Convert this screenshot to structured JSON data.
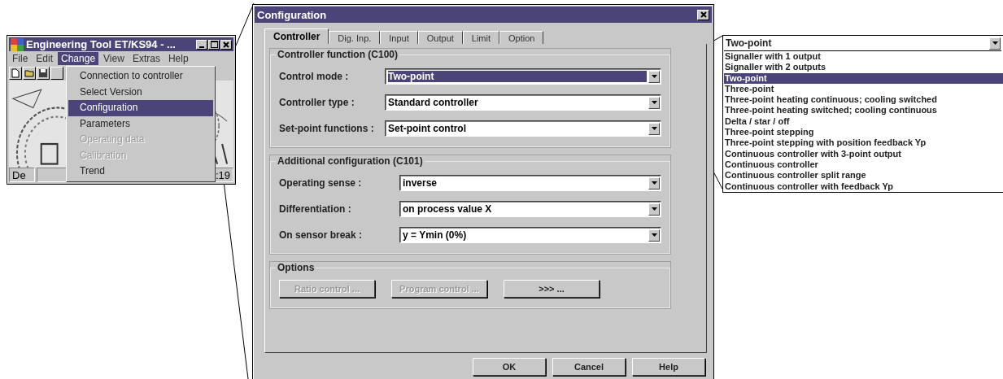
{
  "main_window": {
    "title": "Engineering Tool ET/KS94 - ...",
    "menu": [
      {
        "label": "File",
        "selected": false
      },
      {
        "label": "Edit",
        "selected": false
      },
      {
        "label": "Change",
        "selected": true
      },
      {
        "label": "View",
        "selected": false
      },
      {
        "label": "Extras",
        "selected": false
      },
      {
        "label": "Help",
        "selected": false
      }
    ],
    "change_menu": [
      {
        "label": "Connection to controller",
        "selected": false,
        "disabled": false
      },
      {
        "label": "Select Version",
        "selected": false,
        "disabled": false
      },
      {
        "label": "Configuration",
        "selected": true,
        "disabled": false
      },
      {
        "label": "Parameters",
        "selected": false,
        "disabled": false
      },
      {
        "label": "Operating data",
        "selected": false,
        "disabled": true
      },
      {
        "label": "Calibration",
        "selected": false,
        "disabled": true
      },
      {
        "label": "Trend",
        "selected": false,
        "disabled": false
      }
    ],
    "status_bar": {
      "left": "De",
      "right": ":19"
    }
  },
  "dialog": {
    "title": "Configuration",
    "tabs": [
      {
        "label": "Controller",
        "selected": true
      },
      {
        "label": "Dig. Inp.",
        "selected": false
      },
      {
        "label": "Input",
        "selected": false
      },
      {
        "label": "Output",
        "selected": false
      },
      {
        "label": "Limit",
        "selected": false
      },
      {
        "label": "Option",
        "selected": false
      }
    ],
    "groups": [
      {
        "title": "Controller function (C100)",
        "fields": [
          {
            "label": "Control mode :",
            "value": "Two-point",
            "focused": true
          },
          {
            "label": "Controller type :",
            "value": "Standard controller",
            "focused": false
          },
          {
            "label": "Set-point functions :",
            "value": "Set-point control",
            "focused": false
          }
        ]
      },
      {
        "title": "Additional configuration (C101)",
        "fields": [
          {
            "label": "Operating sense :",
            "value": "inverse",
            "focused": false
          },
          {
            "label": "Differentiation :",
            "value": "on process value X",
            "focused": false
          },
          {
            "label": "On sensor break :",
            "value": "y = Ymin (0%)",
            "focused": false
          }
        ]
      }
    ],
    "options": {
      "title": "Options",
      "buttons": [
        {
          "label": "Ratio control ...",
          "disabled": true
        },
        {
          "label": "Program control ...",
          "disabled": true
        },
        {
          "label": ">>> ...",
          "disabled": false
        }
      ]
    },
    "buttons": [
      "OK",
      "Cancel",
      "Help"
    ]
  },
  "dropdown": {
    "value": "Two-point",
    "items": [
      {
        "label": "Signaller with 1 output",
        "selected": false
      },
      {
        "label": "Signaller with 2 outputs",
        "selected": false
      },
      {
        "label": "Two-point",
        "selected": true
      },
      {
        "label": "Three-point",
        "selected": false
      },
      {
        "label": "Three-point heating continuous; cooling switched",
        "selected": false
      },
      {
        "label": "Three-point heating switched; cooling continuous",
        "selected": false
      },
      {
        "label": "Delta / star / off",
        "selected": false
      },
      {
        "label": "Three-point stepping",
        "selected": false
      },
      {
        "label": "Three-point stepping with position feedback Yp",
        "selected": false
      },
      {
        "label": "Continuous controller with 3-point output",
        "selected": false
      },
      {
        "label": "Continuous controller",
        "selected": false
      },
      {
        "label": "Continuous controller split range",
        "selected": false
      },
      {
        "label": "Continuous controller with feedback Yp",
        "selected": false
      }
    ]
  }
}
